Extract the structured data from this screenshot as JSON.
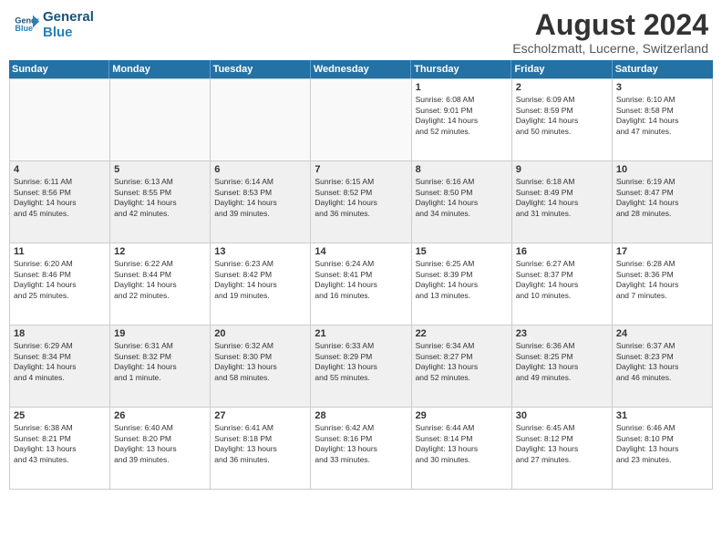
{
  "logo": {
    "line1": "General",
    "line2": "Blue"
  },
  "title": "August 2024",
  "subtitle": "Escholzmatt, Lucerne, Switzerland",
  "days_of_week": [
    "Sunday",
    "Monday",
    "Tuesday",
    "Wednesday",
    "Thursday",
    "Friday",
    "Saturday"
  ],
  "weeks": [
    [
      {
        "day": "",
        "info": ""
      },
      {
        "day": "",
        "info": ""
      },
      {
        "day": "",
        "info": ""
      },
      {
        "day": "",
        "info": ""
      },
      {
        "day": "1",
        "info": "Sunrise: 6:08 AM\nSunset: 9:01 PM\nDaylight: 14 hours\nand 52 minutes."
      },
      {
        "day": "2",
        "info": "Sunrise: 6:09 AM\nSunset: 8:59 PM\nDaylight: 14 hours\nand 50 minutes."
      },
      {
        "day": "3",
        "info": "Sunrise: 6:10 AM\nSunset: 8:58 PM\nDaylight: 14 hours\nand 47 minutes."
      }
    ],
    [
      {
        "day": "4",
        "info": "Sunrise: 6:11 AM\nSunset: 8:56 PM\nDaylight: 14 hours\nand 45 minutes."
      },
      {
        "day": "5",
        "info": "Sunrise: 6:13 AM\nSunset: 8:55 PM\nDaylight: 14 hours\nand 42 minutes."
      },
      {
        "day": "6",
        "info": "Sunrise: 6:14 AM\nSunset: 8:53 PM\nDaylight: 14 hours\nand 39 minutes."
      },
      {
        "day": "7",
        "info": "Sunrise: 6:15 AM\nSunset: 8:52 PM\nDaylight: 14 hours\nand 36 minutes."
      },
      {
        "day": "8",
        "info": "Sunrise: 6:16 AM\nSunset: 8:50 PM\nDaylight: 14 hours\nand 34 minutes."
      },
      {
        "day": "9",
        "info": "Sunrise: 6:18 AM\nSunset: 8:49 PM\nDaylight: 14 hours\nand 31 minutes."
      },
      {
        "day": "10",
        "info": "Sunrise: 6:19 AM\nSunset: 8:47 PM\nDaylight: 14 hours\nand 28 minutes."
      }
    ],
    [
      {
        "day": "11",
        "info": "Sunrise: 6:20 AM\nSunset: 8:46 PM\nDaylight: 14 hours\nand 25 minutes."
      },
      {
        "day": "12",
        "info": "Sunrise: 6:22 AM\nSunset: 8:44 PM\nDaylight: 14 hours\nand 22 minutes."
      },
      {
        "day": "13",
        "info": "Sunrise: 6:23 AM\nSunset: 8:42 PM\nDaylight: 14 hours\nand 19 minutes."
      },
      {
        "day": "14",
        "info": "Sunrise: 6:24 AM\nSunset: 8:41 PM\nDaylight: 14 hours\nand 16 minutes."
      },
      {
        "day": "15",
        "info": "Sunrise: 6:25 AM\nSunset: 8:39 PM\nDaylight: 14 hours\nand 13 minutes."
      },
      {
        "day": "16",
        "info": "Sunrise: 6:27 AM\nSunset: 8:37 PM\nDaylight: 14 hours\nand 10 minutes."
      },
      {
        "day": "17",
        "info": "Sunrise: 6:28 AM\nSunset: 8:36 PM\nDaylight: 14 hours\nand 7 minutes."
      }
    ],
    [
      {
        "day": "18",
        "info": "Sunrise: 6:29 AM\nSunset: 8:34 PM\nDaylight: 14 hours\nand 4 minutes."
      },
      {
        "day": "19",
        "info": "Sunrise: 6:31 AM\nSunset: 8:32 PM\nDaylight: 14 hours\nand 1 minute."
      },
      {
        "day": "20",
        "info": "Sunrise: 6:32 AM\nSunset: 8:30 PM\nDaylight: 13 hours\nand 58 minutes."
      },
      {
        "day": "21",
        "info": "Sunrise: 6:33 AM\nSunset: 8:29 PM\nDaylight: 13 hours\nand 55 minutes."
      },
      {
        "day": "22",
        "info": "Sunrise: 6:34 AM\nSunset: 8:27 PM\nDaylight: 13 hours\nand 52 minutes."
      },
      {
        "day": "23",
        "info": "Sunrise: 6:36 AM\nSunset: 8:25 PM\nDaylight: 13 hours\nand 49 minutes."
      },
      {
        "day": "24",
        "info": "Sunrise: 6:37 AM\nSunset: 8:23 PM\nDaylight: 13 hours\nand 46 minutes."
      }
    ],
    [
      {
        "day": "25",
        "info": "Sunrise: 6:38 AM\nSunset: 8:21 PM\nDaylight: 13 hours\nand 43 minutes."
      },
      {
        "day": "26",
        "info": "Sunrise: 6:40 AM\nSunset: 8:20 PM\nDaylight: 13 hours\nand 39 minutes."
      },
      {
        "day": "27",
        "info": "Sunrise: 6:41 AM\nSunset: 8:18 PM\nDaylight: 13 hours\nand 36 minutes."
      },
      {
        "day": "28",
        "info": "Sunrise: 6:42 AM\nSunset: 8:16 PM\nDaylight: 13 hours\nand 33 minutes."
      },
      {
        "day": "29",
        "info": "Sunrise: 6:44 AM\nSunset: 8:14 PM\nDaylight: 13 hours\nand 30 minutes."
      },
      {
        "day": "30",
        "info": "Sunrise: 6:45 AM\nSunset: 8:12 PM\nDaylight: 13 hours\nand 27 minutes."
      },
      {
        "day": "31",
        "info": "Sunrise: 6:46 AM\nSunset: 8:10 PM\nDaylight: 13 hours\nand 23 minutes."
      }
    ]
  ]
}
